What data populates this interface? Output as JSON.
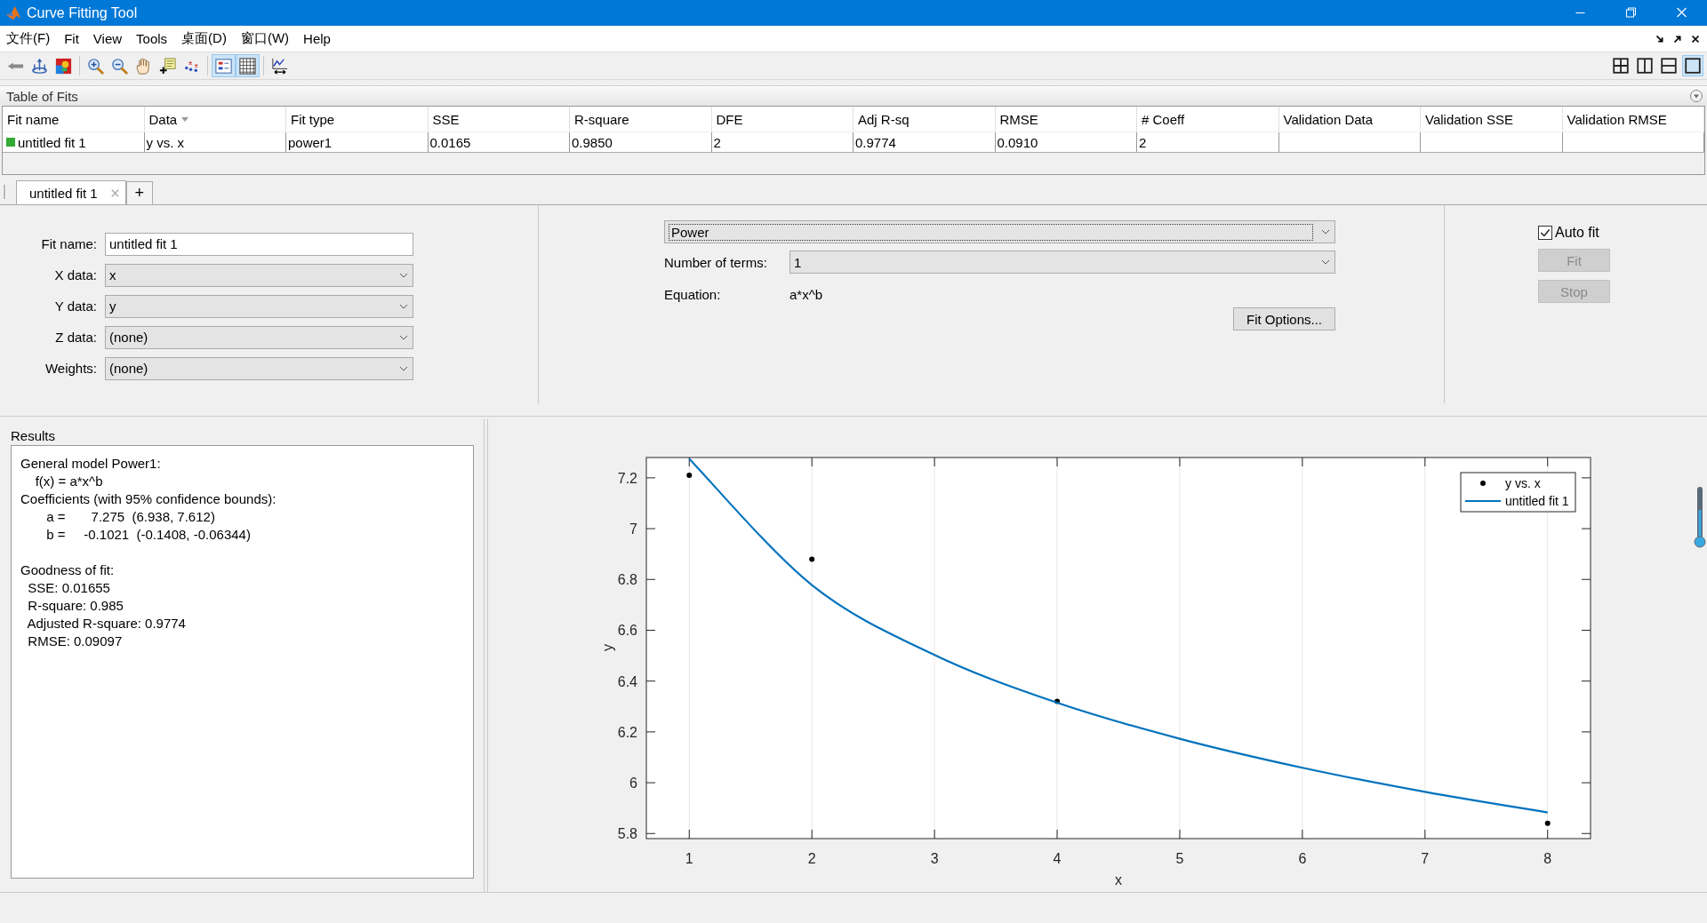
{
  "window": {
    "title": "Curve Fitting Tool"
  },
  "menu": [
    "文件(F)",
    "Fit",
    "View",
    "Tools",
    "桌面(D)",
    "窗口(W)",
    "Help"
  ],
  "toolbar": [
    {
      "kind": "back",
      "on": false
    },
    {
      "kind": "axes",
      "on": false
    },
    {
      "kind": "colormap",
      "on": false
    },
    {
      "kind": "zoom-in",
      "on": false
    },
    {
      "kind": "zoom-out",
      "on": false
    },
    {
      "kind": "pan",
      "on": false
    },
    {
      "kind": "cursor",
      "on": false
    },
    {
      "kind": "exclude",
      "on": false
    },
    {
      "kind": "legend",
      "on": true
    },
    {
      "kind": "grid",
      "on": true
    },
    {
      "kind": "residuals",
      "on": false
    }
  ],
  "layouts": [
    {
      "kind": "quad",
      "selected": false
    },
    {
      "kind": "columns",
      "selected": false
    },
    {
      "kind": "rows",
      "selected": false
    },
    {
      "kind": "single",
      "selected": true
    }
  ],
  "table_of_fits": {
    "title": "Table of Fits",
    "columns": [
      {
        "label": "Fit name",
        "sorted": false
      },
      {
        "label": "Data",
        "sorted": true
      },
      {
        "label": "Fit type",
        "sorted": false
      },
      {
        "label": "SSE",
        "sorted": false
      },
      {
        "label": "R-square",
        "sorted": false
      },
      {
        "label": "DFE",
        "sorted": false
      },
      {
        "label": "Adj R-sq",
        "sorted": false
      },
      {
        "label": "RMSE",
        "sorted": false
      },
      {
        "label": "# Coeff",
        "sorted": false
      },
      {
        "label": "Validation Data",
        "sorted": false
      },
      {
        "label": "Validation SSE",
        "sorted": false
      },
      {
        "label": "Validation RMSE",
        "sorted": false
      }
    ],
    "rows": [
      {
        "color": "#33aa33",
        "cells": [
          "untitled fit 1",
          "y vs. x",
          "power1",
          "0.0165",
          "0.9850",
          "2",
          "0.9774",
          "0.0910",
          "2"
        ]
      }
    ]
  },
  "fit_tabs": [
    {
      "label": "untitled fit 1",
      "selected": true
    }
  ],
  "add_tab": "+",
  "fit_settings": {
    "fields": [
      {
        "label": "Fit name:",
        "kind": "text",
        "value": "untitled fit 1"
      },
      {
        "label": "X data:",
        "kind": "dropdown",
        "value": "x"
      },
      {
        "label": "Y data:",
        "kind": "dropdown",
        "value": "y"
      },
      {
        "label": "Z data:",
        "kind": "dropdown",
        "value": "(none)"
      },
      {
        "label": "Weights:",
        "kind": "dropdown",
        "value": "(none)"
      }
    ],
    "fit_type": "Power",
    "number_of_terms": {
      "label": "Number of terms:",
      "value": "1"
    },
    "equation": {
      "label": "Equation:",
      "value": "a*x^b"
    },
    "fit_options_button": "Fit Options...",
    "auto_fit": {
      "label": "Auto fit",
      "checked": true
    },
    "fit_button": {
      "label": "Fit",
      "disabled": true
    },
    "stop_button": {
      "label": "Stop",
      "disabled": true
    }
  },
  "results": {
    "title": "Results",
    "blocks": [
      [
        "General model Power1:",
        "    f(x) = a*x^b",
        "Coefficients (with 95% confidence bounds):",
        "       a =       7.275  (6.938, 7.612)",
        "       b =     -0.1021  (-0.1408, -0.06344)"
      ],
      [
        "Goodness of fit:",
        "  SSE: 0.01655",
        "  R-square: 0.985",
        "  Adjusted R-square: 0.9774",
        "  RMSE: 0.09097"
      ]
    ]
  },
  "plot": {
    "chart_data": {
      "type": "scatter",
      "grid": true,
      "legend": "top-right",
      "xlabel": "x",
      "ylabel": "y",
      "x": [
        1,
        2,
        3,
        4,
        5,
        6,
        7,
        8
      ],
      "series": [
        {
          "name": "y vs. x",
          "color": "#000000",
          "values": [
            7.21,
            6.88,
            null,
            6.32,
            null,
            null,
            null,
            5.84
          ]
        },
        {
          "name": "untitled fit 1",
          "type": "line",
          "color": "#0072bd",
          "values": [
            7.275,
            6.778,
            6.503,
            6.315,
            6.173,
            6.059,
            5.964,
            5.883
          ]
        }
      ],
      "xlim": [
        0.65,
        8.35
      ],
      "ylim": [
        5.78,
        7.28
      ],
      "xticks": [
        1,
        2,
        3,
        4,
        5,
        6,
        7,
        8
      ],
      "yticks": [
        5.8,
        6,
        6.2,
        6.4,
        6.6,
        6.8,
        7,
        7.2
      ]
    }
  }
}
